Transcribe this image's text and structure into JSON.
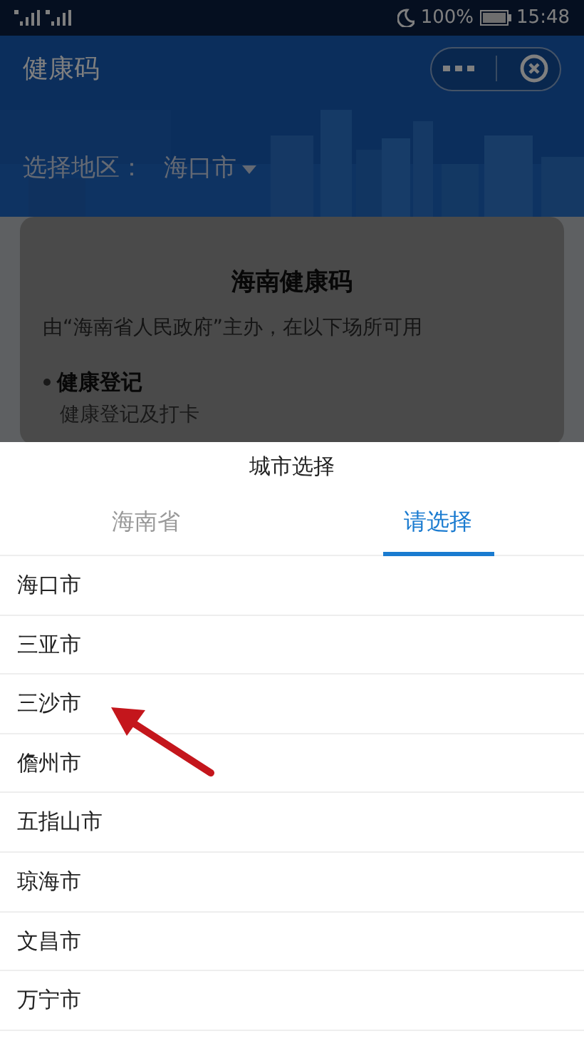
{
  "status_bar": {
    "battery": "100%",
    "time": "15:48"
  },
  "header": {
    "title": "健康码"
  },
  "region": {
    "label": "选择地区：",
    "value": "海口市"
  },
  "card": {
    "title": "海南健康码",
    "subtitle": "由“海南省人民政府”主办，在以下场所可用",
    "services": [
      {
        "title": "健康登记",
        "desc": "健康登记及打卡"
      }
    ]
  },
  "sheet": {
    "title": "城市选择",
    "tabs": [
      {
        "label": "海南省",
        "selected": false
      },
      {
        "label": "请选择",
        "selected": true
      }
    ],
    "cities": [
      "海口市",
      "三亚市",
      "三沙市",
      "儋州市",
      "五指山市",
      "琼海市",
      "文昌市",
      "万宁市"
    ]
  }
}
